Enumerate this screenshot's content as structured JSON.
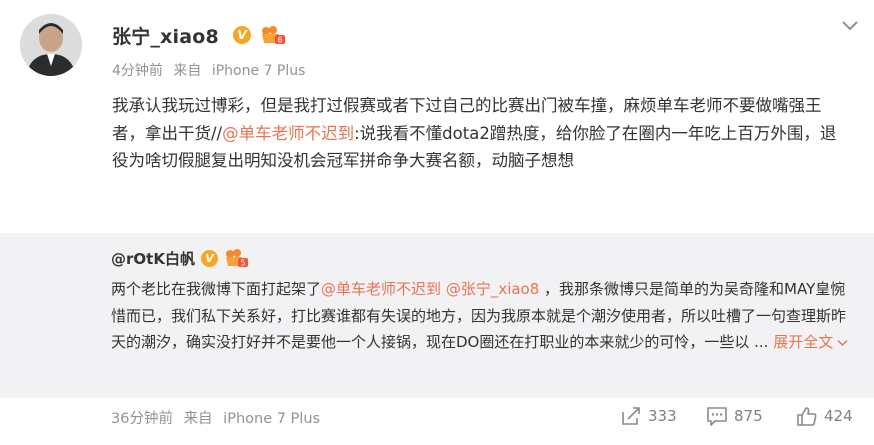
{
  "post": {
    "author": "张宁_xiao8",
    "time": "4分钟前",
    "source_prefix": "来自",
    "source": "iPhone 7 Plus",
    "text_1": "我承认我玩过博彩，但是我打过假赛或者下过自己的比赛出门被车撞，麻烦单车老师不要做嘴强王者，拿出干货//",
    "mention_1": "@单车老师不迟到",
    "text_2": ":说我看不懂dota2蹭热度，给你脸了在圈内一年吃上百万外围，退役为啥切假腿复出明知没机会冠军拼命争大赛名额，动脑子想想"
  },
  "quote": {
    "author": "@rOtK白帆",
    "text_1": "两个老比在我微博下面打起架了",
    "mention_1": "@单车老师不迟到",
    "mention_2": "@张宁_xiao8",
    "text_2": " ，我那条微博只是简单的为吴奇隆和MAY皇惋惜而已，我们私下关系好，打比赛谁都有失误的地方，因为我原本就是个潮汐使用者，所以吐槽了一句查理斯昨天的潮汐，确实没打好并不是要他一个人接锅，现在DO圈还在打职业的本来就少的可怜，一些以 ... ",
    "expand_label": "展开全文"
  },
  "footer": {
    "time": "36分钟前",
    "source_prefix": "来自",
    "source": "iPhone 7 Plus",
    "repost_count": "333",
    "comment_count": "875",
    "like_count": "424"
  },
  "colors": {
    "mention": "#eb7350",
    "quote_bg": "#f2f2f5",
    "badge": "#f5a623",
    "meta": "#939393"
  },
  "icons": [
    "avatar",
    "verified-badge-icon",
    "level-badge-icon",
    "chevron-down-icon",
    "repost-icon",
    "comment-icon",
    "like-icon"
  ]
}
